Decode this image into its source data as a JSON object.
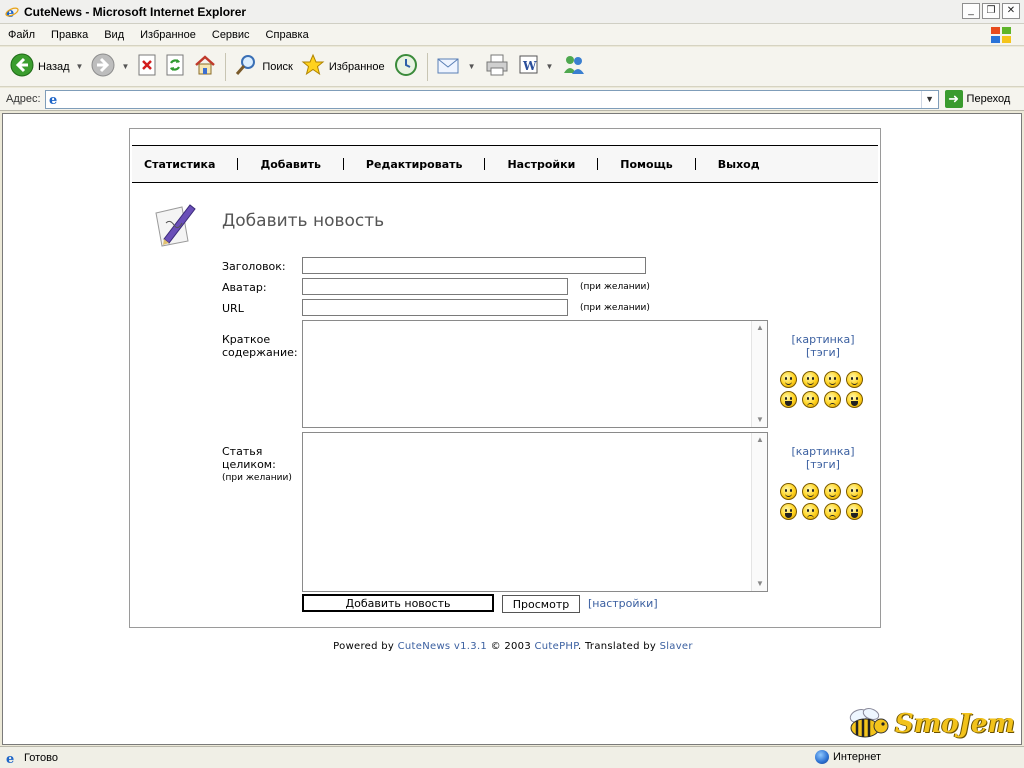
{
  "window": {
    "title": "CuteNews - Microsoft Internet Explorer",
    "controls": [
      "_",
      "❐",
      "✕"
    ]
  },
  "menubar": {
    "items": [
      "Файл",
      "Правка",
      "Вид",
      "Избранное",
      "Сервис",
      "Справка"
    ]
  },
  "toolbar": {
    "back_label": "Назад",
    "search_label": "Поиск",
    "favorites_label": "Избранное"
  },
  "address": {
    "label": "Адрес:",
    "value": "",
    "go_label": "Переход"
  },
  "cutenews": {
    "nav": [
      "Статистика",
      "Добавить",
      "Редактировать",
      "Настройки",
      "Помощь",
      "Выход"
    ],
    "heading": "Добавить новость",
    "fields": {
      "title_label": "Заголовок:",
      "avatar_label": "Аватар:",
      "url_label": "URL",
      "optional_hint": "(при желании)",
      "short_label_line1": "Краткое",
      "short_label_line2": "содержание:",
      "full_label_line1": "Статья",
      "full_label_line2": "целиком:",
      "full_label_hint": "(при желании)"
    },
    "side_links": {
      "image": "[картинка]",
      "tags": "[тэги]"
    },
    "buttons": {
      "add": "Добавить новость",
      "preview": "Просмотр",
      "settings": "[настройки]"
    },
    "footer": {
      "powered": "Powered by ",
      "cutenews": "CuteNews v1.3.1",
      "copy": " © 2003 ",
      "cutephp": "CutePHP",
      "translated": ". Translated by ",
      "slaver": "Slaver"
    }
  },
  "watermark": "SmoJem",
  "status": {
    "text": "Готово",
    "zone": "Интернет"
  }
}
